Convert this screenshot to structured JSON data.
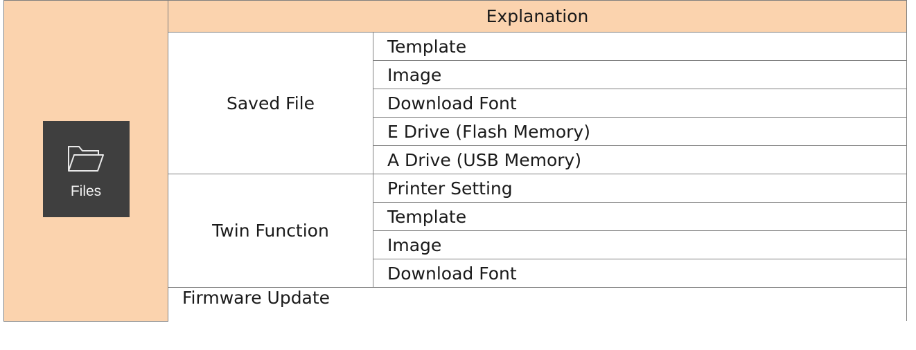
{
  "icon_tile": {
    "icon": "folder-icon",
    "label": "Files"
  },
  "header": {
    "title": "Explanation"
  },
  "groups": [
    {
      "name": "Saved File",
      "items": [
        "Template",
        "Image",
        "Download Font",
        "E Drive (Flash Memory)",
        "A Drive (USB Memory)"
      ]
    },
    {
      "name": "Twin Function",
      "items": [
        "Printer Setting",
        "Template",
        "Image",
        "Download Font"
      ]
    }
  ],
  "firmware": {
    "label": "Firmware Update"
  },
  "colors": {
    "header_bg": "#fbd3ae",
    "tile_bg": "#3f3f3f",
    "border": "#7f7f7f"
  }
}
